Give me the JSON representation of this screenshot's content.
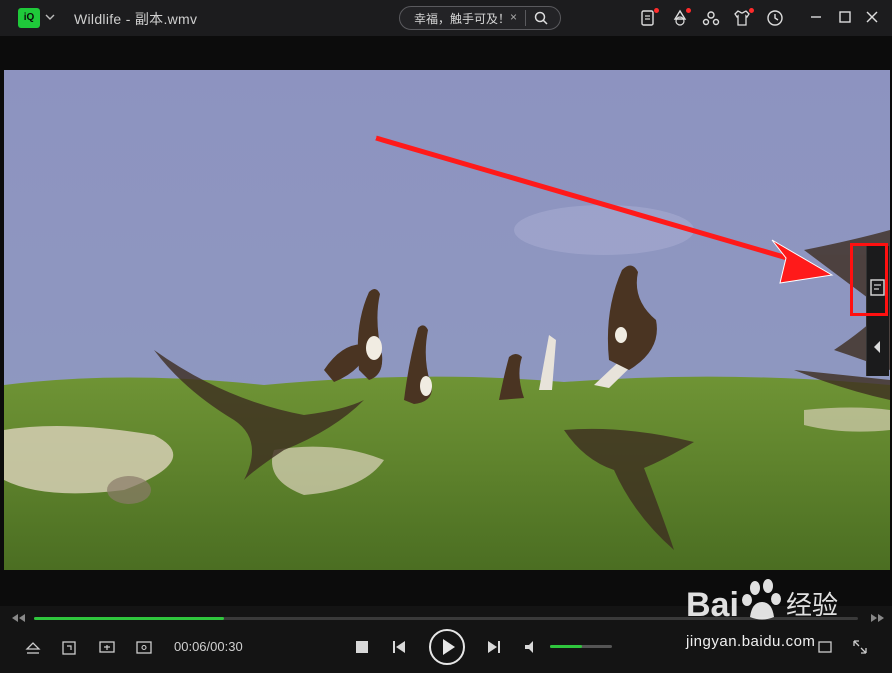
{
  "window": {
    "title": "Wildlife - 副本.wmv",
    "logo_text": "爱奇艺"
  },
  "search": {
    "text": "幸福，触手可及！",
    "clear": "×"
  },
  "player": {
    "time": "00:06/00:30",
    "progress": 0.23,
    "volume": 0.52
  },
  "watermark": {
    "brand": "Bai",
    "brand_cn": "经验",
    "url": "jingyan.baidu.com"
  },
  "colors": {
    "accent": "#2fc63d",
    "highlight": "#ff1010",
    "titlebar": "#1c1c1e"
  }
}
